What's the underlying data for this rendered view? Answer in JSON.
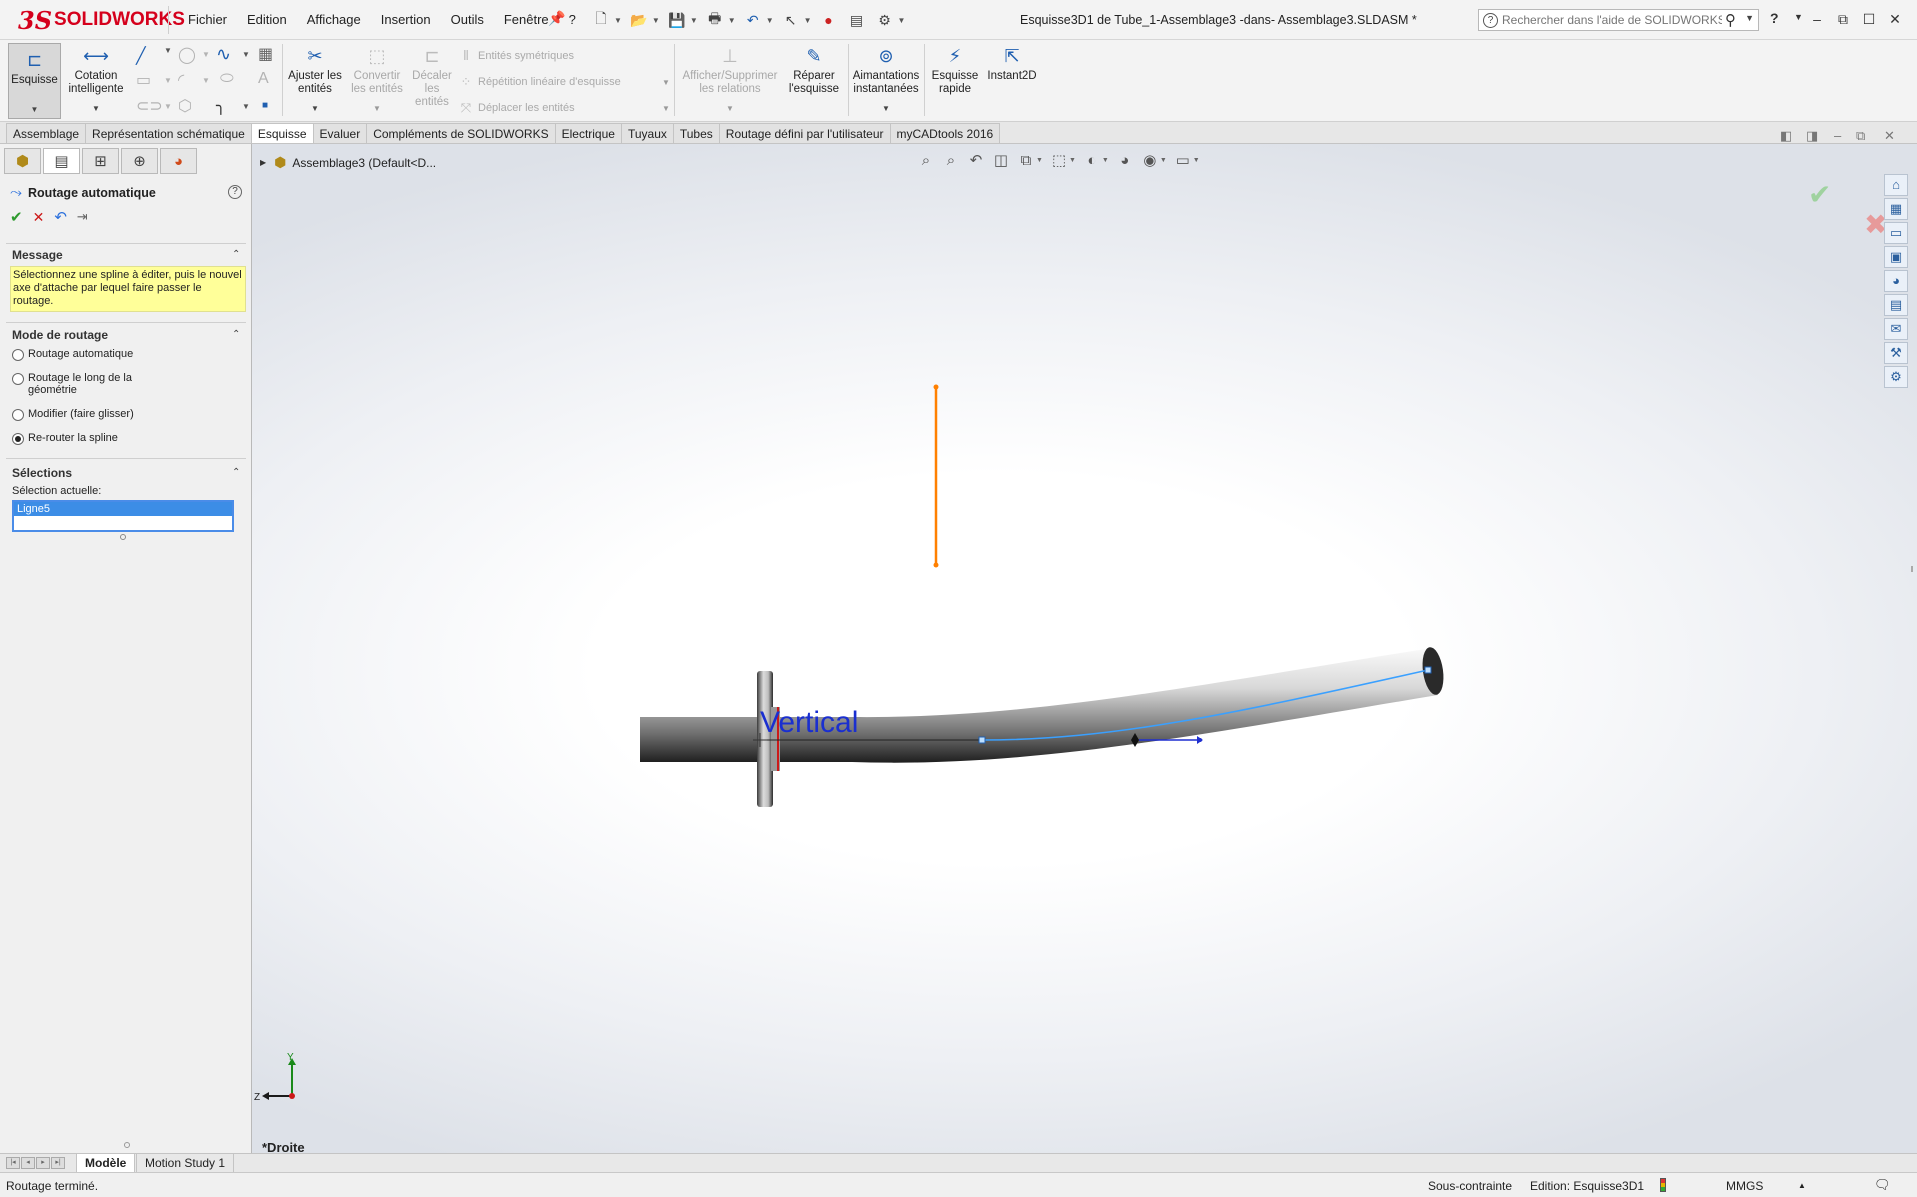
{
  "app": {
    "logo_prefix": "3S",
    "logo_brand_a": "SOLID",
    "logo_brand_b": "WORKS",
    "document_title": "Esquisse3D1 de Tube_1-Assemblage3 -dans- Assemblage3.SLDASM *",
    "menu": [
      "Fichier",
      "Edition",
      "Affichage",
      "Insertion",
      "Outils",
      "Fenêtre",
      "?"
    ],
    "help_search_placeholder": "Rechercher dans l'aide de SOLIDWORKS",
    "help_label": "?"
  },
  "ribbon": {
    "esquisse": "Esquisse",
    "cotation_1": "Cotation",
    "cotation_2": "intelligente",
    "ajuster_1": "Ajuster les",
    "ajuster_2": "entités",
    "convertir_1": "Convertir",
    "convertir_2": "les entités",
    "decaler_1": "Décaler",
    "decaler_2": "les",
    "decaler_3": "entités",
    "entites_sym": "Entités symétriques",
    "repetition": "Répétition linéaire d'esquisse",
    "deplacer": "Déplacer les entités",
    "afficher_1": "Afficher/Supprimer",
    "afficher_2": "les relations",
    "reparer_1": "Réparer",
    "reparer_2": "l'esquisse",
    "aimant_1": "Aimantations",
    "aimant_2": "instantanées",
    "esquisse_rapide_1": "Esquisse",
    "esquisse_rapide_2": "rapide",
    "instant2d": "Instant2D"
  },
  "tabs": [
    "Assemblage",
    "Représentation schématique",
    "Esquisse",
    "Evaluer",
    "Compléments de SOLIDWORKS",
    "Electrique",
    "Tuyaux",
    "Tubes",
    "Routage défini par l'utilisateur",
    "myCADtools 2016"
  ],
  "active_tab": "Esquisse",
  "property_manager": {
    "title": "Routage automatique",
    "help": "?",
    "message_title": "Message",
    "message_text": "Sélectionnez une spline à éditer, puis le nouvel axe d'attache par lequel faire passer le routage.",
    "mode_title": "Mode de routage",
    "modes": [
      {
        "label": "Routage automatique",
        "selected": false
      },
      {
        "label": "Routage le long de la géométrie",
        "selected": false
      },
      {
        "label": "Modifier (faire glisser)",
        "selected": false
      },
      {
        "label": "Re-router la spline",
        "selected": true
      }
    ],
    "selections_title": "Sélections",
    "current_selection_label": "Sélection actuelle:",
    "current_selection_value": "Ligne5"
  },
  "graphics": {
    "tree_root": "Assemblage3  (Default<D...",
    "view_name": "*Droite",
    "relation_label": "Vertical",
    "axis_y": "Y",
    "axis_z": "Z",
    "colors": {
      "orange_line": "#ff8000",
      "blue_spline": "#3aa0ff",
      "relation_text": "#1a2fd0"
    }
  },
  "bottom_tabs": [
    "Modèle",
    "Motion Study 1"
  ],
  "status": {
    "left": "Routage terminé.",
    "constraint": "Sous-contrainte",
    "edit": "Edition: Esquisse3D1",
    "units": "MMGS"
  }
}
